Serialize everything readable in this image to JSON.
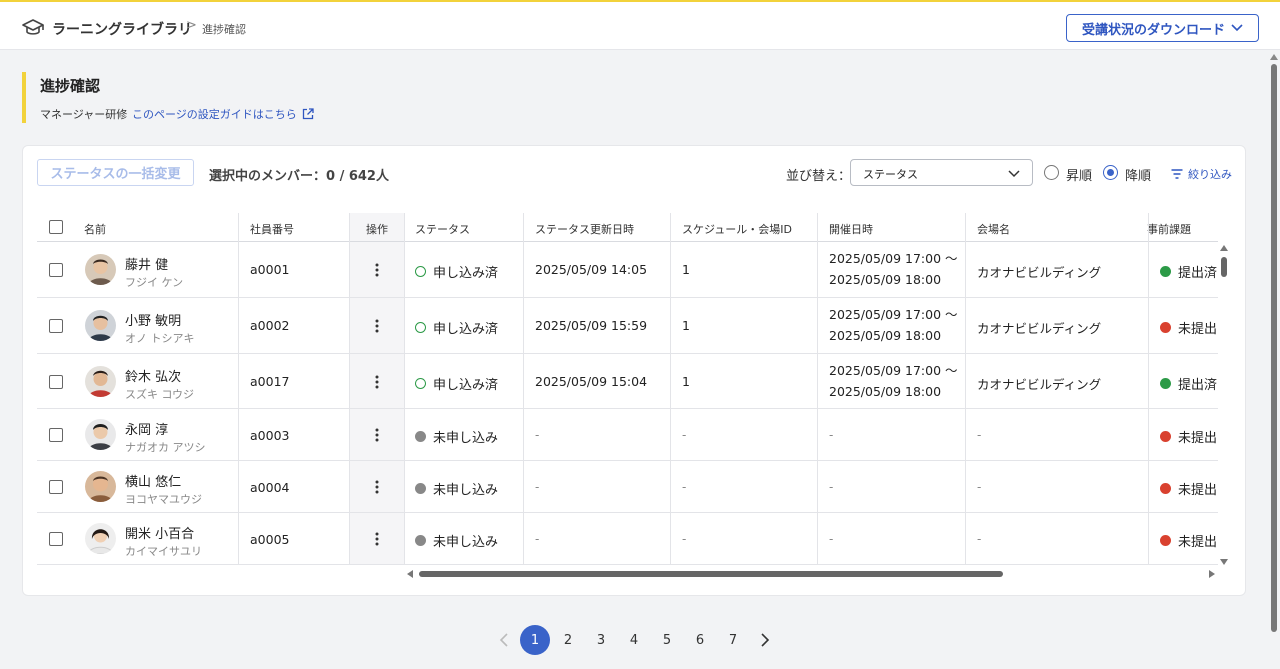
{
  "header": {
    "app_title": "ラーニングライブラリ",
    "breadcrumb_sep": ">",
    "breadcrumb_current": "進捗確認",
    "download_button": "受講状況のダウンロード"
  },
  "page": {
    "title": "進捗確認",
    "subtitle": "マネージャー研修",
    "guide_link": "このページの設定ガイドはこちら"
  },
  "toolbar": {
    "bulk_change_button": "ステータスの一括変更",
    "selected_count": "選択中のメンバー：0 / 642人",
    "sort_label": "並び替え：",
    "sort_value": "ステータス",
    "order_asc": "昇順",
    "order_desc": "降順",
    "order_selected": "desc",
    "filter_label": "絞り込み"
  },
  "table": {
    "headers": {
      "name": "名前",
      "employee_id": "社員番号",
      "action": "操作",
      "status": "ステータス",
      "status_updated": "ステータス更新日時",
      "schedule_id": "スケジュール・会場ID",
      "date": "開催日時",
      "venue": "会場名",
      "pre_task": "事前課題"
    },
    "rows": [
      {
        "name": "藤井 健",
        "kana": "フジイ ケン",
        "employee_id": "a0001",
        "status": "申し込み済",
        "status_updated": "2025/05/09 14:05",
        "schedule_id": "1",
        "date_start": "2025/05/09 17:00 〜",
        "date_end": "2025/05/09 18:00",
        "venue": "カオナビビルディング",
        "pre_task": "提出済"
      },
      {
        "name": "小野 敏明",
        "kana": "オノ トシアキ",
        "employee_id": "a0002",
        "status": "申し込み済",
        "status_updated": "2025/05/09 15:59",
        "schedule_id": "1",
        "date_start": "2025/05/09 17:00 〜",
        "date_end": "2025/05/09 18:00",
        "venue": "カオナビビルディング",
        "pre_task": "未提出"
      },
      {
        "name": "鈴木 弘次",
        "kana": "スズキ コウジ",
        "employee_id": "a0017",
        "status": "申し込み済",
        "status_updated": "2025/05/09 15:04",
        "schedule_id": "1",
        "date_start": "2025/05/09 17:00 〜",
        "date_end": "2025/05/09 18:00",
        "venue": "カオナビビルディング",
        "pre_task": "提出済"
      },
      {
        "name": "永岡 淳",
        "kana": "ナガオカ アツシ",
        "employee_id": "a0003",
        "status": "未申し込み",
        "status_updated": "-",
        "schedule_id": "-",
        "date_start": "-",
        "date_end": "",
        "venue": "-",
        "pre_task": "未提出"
      },
      {
        "name": "横山 悠仁",
        "kana": "ヨコヤマユウジ",
        "employee_id": "a0004",
        "status": "未申し込み",
        "status_updated": "-",
        "schedule_id": "-",
        "date_start": "-",
        "date_end": "",
        "venue": "-",
        "pre_task": "未提出"
      },
      {
        "name": "開米 小百合",
        "kana": "カイマイサユリ",
        "employee_id": "a0005",
        "status": "未申し込み",
        "status_updated": "-",
        "schedule_id": "-",
        "date_start": "-",
        "date_end": "",
        "venue": "-",
        "pre_task": "未提出"
      }
    ]
  },
  "pagination": {
    "pages": [
      "1",
      "2",
      "3",
      "4",
      "5",
      "6",
      "7"
    ],
    "current": "1"
  },
  "colors": {
    "accent": "#3a63c9",
    "highlight_bar": "#f2d23b",
    "submitted": "#2c9a47",
    "not_submitted": "#d9412f",
    "not_applied": "#888888"
  },
  "icons": {
    "app": "graduation-cap-icon",
    "external": "external-link-icon",
    "filter": "filter-icon",
    "more": "kebab-menu-icon"
  }
}
